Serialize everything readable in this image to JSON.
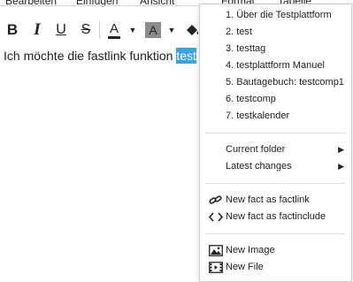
{
  "menubar": {
    "items": [
      "Bearbeiten",
      "Einfügen",
      "Ansicht",
      "Format",
      "Tabelle"
    ]
  },
  "toolbar": {
    "bold": "B",
    "italic": "I",
    "underline": "U",
    "strikethrough": "S",
    "font_color": "A",
    "bg_color": "A",
    "dropdown": "▼"
  },
  "content": {
    "text_before": "Ich möchte die fastlink funktion ",
    "selected": "test"
  },
  "context_menu": {
    "numbered_items": [
      "1. Über die Testplattform",
      "2. test",
      "3. testtag",
      "4. testplattform Manuel",
      "5. Bautagebuch: testcomp1",
      "6. testcomp",
      "7. testkalender"
    ],
    "submenus": [
      {
        "label": "Current folder",
        "chevron": "▶"
      },
      {
        "label": "Latest changes",
        "chevron": "▶"
      }
    ],
    "fact_items": [
      {
        "label": "New fact as factlink",
        "icon": "link-icon"
      },
      {
        "label": "New fact as factinclude",
        "icon": "code-icon"
      }
    ],
    "media_items": [
      {
        "label": "New Image",
        "icon": "image-icon"
      },
      {
        "label": "New File",
        "icon": "film-icon"
      }
    ]
  },
  "colors": {
    "selection": "#3aa3e3",
    "bg_swatch": "#8c8c8c"
  }
}
